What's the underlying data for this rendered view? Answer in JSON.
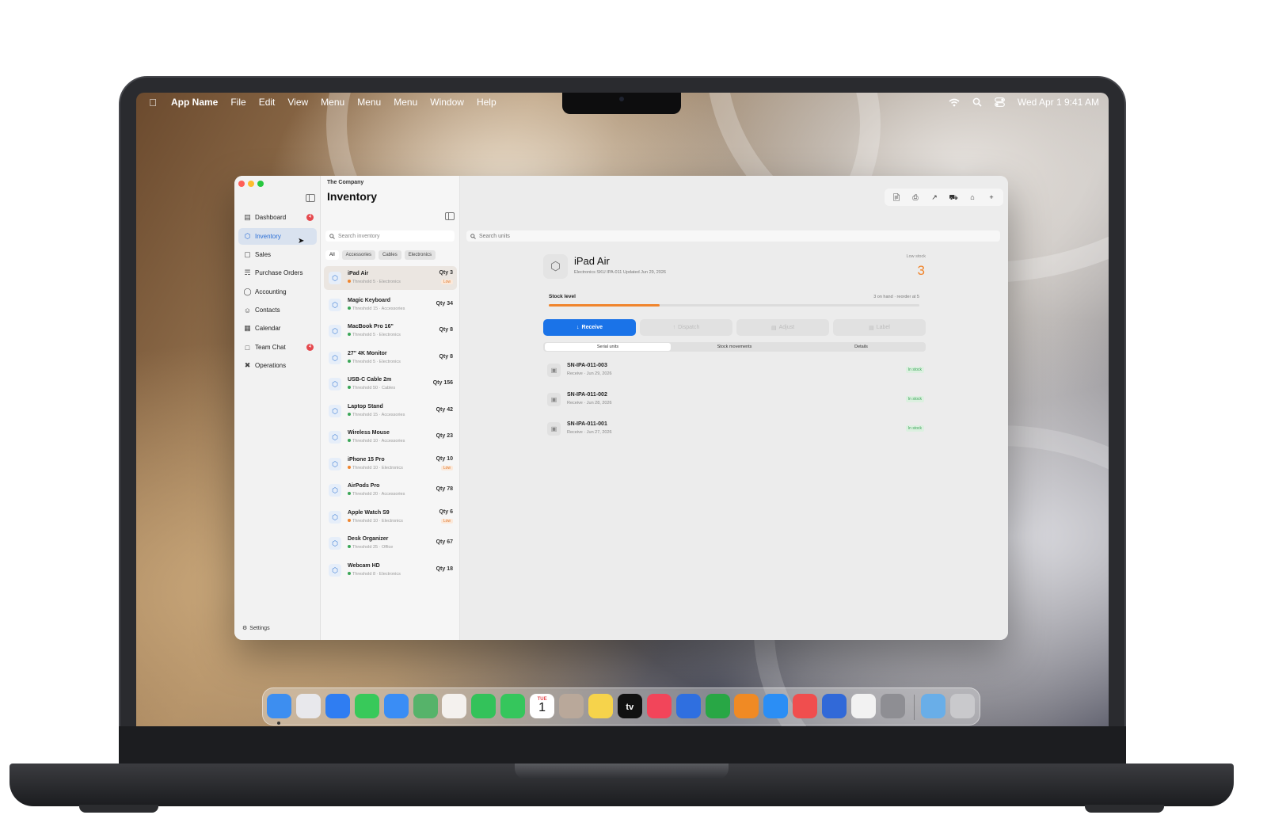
{
  "menubar": {
    "app_name": "App Name",
    "menus": [
      "File",
      "Edit",
      "View",
      "Menu",
      "Menu",
      "Menu",
      "Window",
      "Help"
    ],
    "datetime": "Wed Apr 1  9:41 AM"
  },
  "sidebar": {
    "items": [
      {
        "label": "Dashboard",
        "icon": "dashboard-icon",
        "badge": "4"
      },
      {
        "label": "Inventory",
        "icon": "inventory-icon",
        "active": true
      },
      {
        "label": "Sales",
        "icon": "bag-icon"
      },
      {
        "label": "Purchase Orders",
        "icon": "cart-icon"
      },
      {
        "label": "Accounting",
        "icon": "dollar-icon"
      },
      {
        "label": "Contacts",
        "icon": "people-icon"
      },
      {
        "label": "Calendar",
        "icon": "calendar-icon"
      },
      {
        "label": "Team Chat",
        "icon": "chat-icon",
        "badge": "4"
      },
      {
        "label": "Operations",
        "icon": "tools-icon"
      }
    ],
    "settings_label": "Settings"
  },
  "list": {
    "company": "The Company",
    "title": "Inventory",
    "search_placeholder": "Search inventory",
    "filters": [
      "All",
      "Accessories",
      "Cables",
      "Electronics"
    ],
    "items": [
      {
        "name": "iPad Air",
        "sub": "Threshold 5 · Electronics",
        "qty": "Qty 3",
        "low": "Low",
        "dot": "#f0852d"
      },
      {
        "name": "Magic Keyboard",
        "sub": "Threshold 15 · Accessories",
        "qty": "Qty 34",
        "low": "",
        "dot": "#3aa657"
      },
      {
        "name": "MacBook Pro 16\"",
        "sub": "Threshold 5 · Electronics",
        "qty": "Qty 8",
        "low": "",
        "dot": "#3aa657"
      },
      {
        "name": "27\" 4K Monitor",
        "sub": "Threshold 5 · Electronics",
        "qty": "Qty 8",
        "low": "",
        "dot": "#3aa657"
      },
      {
        "name": "USB-C Cable 2m",
        "sub": "Threshold 50 · Cables",
        "qty": "Qty 156",
        "low": "",
        "dot": "#3aa657"
      },
      {
        "name": "Laptop Stand",
        "sub": "Threshold 15 · Accessories",
        "qty": "Qty 42",
        "low": "",
        "dot": "#3aa657"
      },
      {
        "name": "Wireless Mouse",
        "sub": "Threshold 10 · Accessories",
        "qty": "Qty 23",
        "low": "",
        "dot": "#3aa657"
      },
      {
        "name": "iPhone 15 Pro",
        "sub": "Threshold 10 · Electronics",
        "qty": "Qty 10",
        "low": "Low",
        "dot": "#f0852d"
      },
      {
        "name": "AirPods Pro",
        "sub": "Threshold 20 · Accessories",
        "qty": "Qty 78",
        "low": "",
        "dot": "#3aa657"
      },
      {
        "name": "Apple Watch S9",
        "sub": "Threshold 10 · Electronics",
        "qty": "Qty 6",
        "low": "Low",
        "dot": "#f0852d"
      },
      {
        "name": "Desk Organizer",
        "sub": "Threshold 25 · Office",
        "qty": "Qty 67",
        "low": "",
        "dot": "#3aa657"
      },
      {
        "name": "Webcam HD",
        "sub": "Threshold 8 · Electronics",
        "qty": "Qty 18",
        "low": "",
        "dot": "#3aa657"
      }
    ]
  },
  "detail": {
    "search_placeholder": "Search units",
    "product": {
      "name": "iPad Air",
      "meta": "Electronics   SKU IPA-011   Updated Jun 29, 2026",
      "low_label": "Low stock",
      "low_value": "3"
    },
    "stock": {
      "label": "Stock level",
      "note": "3 on hand · reorder at 5",
      "fraction": 0.3
    },
    "actions": {
      "receive": "Receive",
      "dispatch": "Dispatch",
      "adjust": "Adjust",
      "label": "Label"
    },
    "tabs": [
      "Serial units",
      "Stock movements",
      "Details"
    ],
    "units": [
      {
        "sn": "SN-IPA-011-003",
        "sub": "Receive · Jun 29, 2026",
        "status": "In stock"
      },
      {
        "sn": "SN-IPA-011-002",
        "sub": "Receive · Jun 28, 2026",
        "status": "In stock"
      },
      {
        "sn": "SN-IPA-011-001",
        "sub": "Receive · Jun 27, 2026",
        "status": "In stock"
      }
    ]
  },
  "dock": {
    "apps": [
      {
        "name": "finder",
        "color": "#3d8ef0"
      },
      {
        "name": "launchpad",
        "color": "#e8e8ec"
      },
      {
        "name": "safari",
        "color": "#2f7df2"
      },
      {
        "name": "messages",
        "color": "#38c95a"
      },
      {
        "name": "mail",
        "color": "#3a8df5"
      },
      {
        "name": "maps",
        "color": "#56b36a"
      },
      {
        "name": "photos",
        "color": "#f4f1ee"
      },
      {
        "name": "facetime",
        "color": "#33c25a"
      },
      {
        "name": "phone",
        "color": "#35c65c"
      },
      {
        "name": "calendar",
        "color": "#ffffff"
      },
      {
        "name": "contacts",
        "color": "#b9a89a"
      },
      {
        "name": "notes",
        "color": "#f6d34b"
      },
      {
        "name": "tv",
        "color": "#111111"
      },
      {
        "name": "music",
        "color": "#f2455a"
      },
      {
        "name": "keynote",
        "color": "#2f6fe0"
      },
      {
        "name": "numbers",
        "color": "#28a745"
      },
      {
        "name": "pages",
        "color": "#f08a24"
      },
      {
        "name": "app-store",
        "color": "#2b8ef5"
      },
      {
        "name": "rocket",
        "color": "#f04e4e"
      },
      {
        "name": "simulator",
        "color": "#3169d8"
      },
      {
        "name": "steering",
        "color": "#f2f2f2"
      },
      {
        "name": "system-settings",
        "color": "#8e8e93"
      },
      {
        "name": "folder",
        "color": "#69aee8"
      },
      {
        "name": "trash",
        "color": "#c9c9cc"
      }
    ],
    "calendar_day": "1",
    "calendar_month": "TUE",
    "tv_text": "tv"
  }
}
